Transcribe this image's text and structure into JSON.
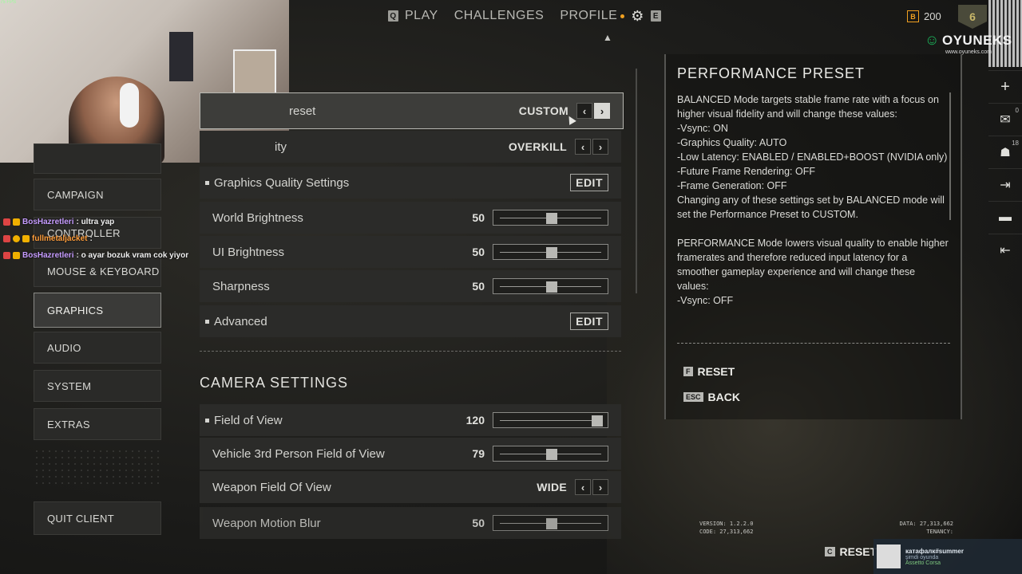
{
  "topnav": {
    "play_key": "Q",
    "play": "PLAY",
    "challenges": "CHALLENGES",
    "profile": "PROFILE",
    "right_key": "E"
  },
  "wallet": {
    "coin_label": "B",
    "amount": "200"
  },
  "level": {
    "value": "6"
  },
  "brand": {
    "name": "OYUNEKS",
    "url": "www.oyuneks.com"
  },
  "rail": {
    "mail_count": "0",
    "friends_count": "18"
  },
  "fps_overlay": "75 FPS",
  "left_menu": {
    "campaign": "CAMPAIGN",
    "controller": "CONTROLLER",
    "mouse_keyboard": "MOUSE & KEYBOARD",
    "graphics": "GRAPHICS",
    "audio": "AUDIO",
    "system": "SYSTEM",
    "extras": "EXTRAS",
    "quit": "QUIT CLIENT"
  },
  "chat": [
    {
      "user": "BosHazretleri",
      "text": ": ultra yap",
      "color": "#c69cff"
    },
    {
      "user": "fullmetaljacket",
      "text": ":",
      "color": "#ff9d3b"
    },
    {
      "user": "BosHazretleri",
      "text": ": o ayar bozuk vram cok yiyor",
      "color": "#c69cff"
    }
  ],
  "settings": {
    "performance_preset": {
      "label": "reset",
      "value": "CUSTOM"
    },
    "graphics_quality": {
      "label": "ity",
      "value": "OVERKILL"
    },
    "quality_settings": {
      "label": "Graphics Quality Settings",
      "button": "EDIT"
    },
    "world_brightness": {
      "label": "World Brightness",
      "value": "50",
      "fraction": 0.5
    },
    "ui_brightness": {
      "label": "UI Brightness",
      "value": "50",
      "fraction": 0.5
    },
    "sharpness": {
      "label": "Sharpness",
      "value": "50",
      "fraction": 0.5
    },
    "advanced": {
      "label": "Advanced",
      "button": "EDIT"
    }
  },
  "camera": {
    "title": "CAMERA SETTINGS",
    "fov": {
      "label": "Field of View",
      "value": "120",
      "fraction": 1.0
    },
    "vehicle_fov": {
      "label": "Vehicle 3rd Person Field of View",
      "value": "79",
      "fraction": 0.5
    },
    "weapon_fov": {
      "label": "Weapon Field Of View",
      "value": "WIDE"
    },
    "weapon_blur": {
      "label": "Weapon Motion Blur",
      "value": "50",
      "fraction": 0.5
    }
  },
  "panel": {
    "title": "PERFORMANCE PRESET",
    "body": "BALANCED Mode targets stable frame rate with a focus on higher visual fidelity and will change these values:\n-Vsync: ON\n-Graphics Quality: AUTO\n-Low Latency: ENABLED / ENABLED+BOOST (NVIDIA only)\n-Future Frame Rendering: OFF\n-Frame Generation: OFF\nChanging any of these settings set by BALANCED mode will set the Performance Preset to CUSTOM.\n\nPERFORMANCE Mode lowers visual quality to enable higher framerates and therefore reduced input latency for a smoother gameplay experience and will change these values:\n-Vsync: OFF",
    "reset_key": "F",
    "reset": "RESET",
    "back_key": "ESC",
    "back": "BACK"
  },
  "footer": {
    "version": "VERSION: 1.2.2.0",
    "code": "CODE: 27,313,662",
    "data": "DATA: 27,313,662",
    "tenancy": "TENANCY:",
    "reset_key": "C",
    "reset": "RESET"
  },
  "notification": {
    "name": "катафалк#summer",
    "status": "şimdi oyunda",
    "game": "Assetto Corsa"
  }
}
